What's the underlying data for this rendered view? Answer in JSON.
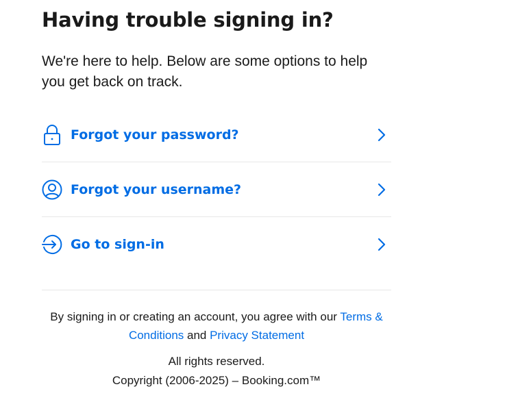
{
  "page": {
    "title": "Having trouble signing in?",
    "intro": "We're here to help. Below are some options to help you get back on track."
  },
  "options": [
    {
      "label": "Forgot your password?",
      "icon": "lock-icon"
    },
    {
      "label": "Forgot your username?",
      "icon": "user-circle-icon"
    },
    {
      "label": "Go to sign-in",
      "icon": "sign-in-arrow-icon"
    }
  ],
  "footer": {
    "legal_prefix": "By signing in or creating an account, you agree with our ",
    "terms_link": "Terms & Conditions",
    "legal_and": " and ",
    "privacy_link": "Privacy Statement",
    "rights": "All rights reserved.",
    "copyright": "Copyright (2006-2025) – Booking.com™"
  },
  "colors": {
    "accent": "#006ce4",
    "text": "#1a1a1a",
    "divider": "#e7e7e7",
    "background": "#ffffff"
  }
}
